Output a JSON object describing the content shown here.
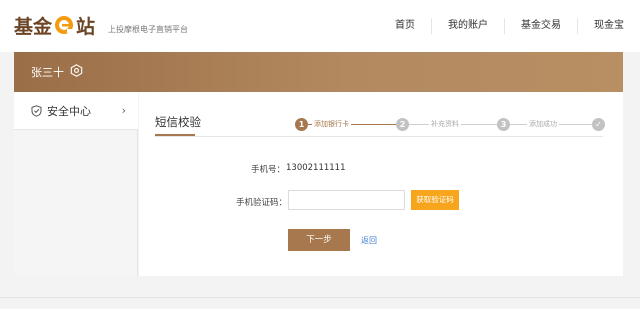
{
  "header": {
    "logo": {
      "part1": "基金",
      "part2": "站",
      "accent": "#f39c12",
      "color": "#6b4526"
    },
    "tagline": "上投摩根电子直销平台",
    "nav": [
      "首页",
      "我的账户",
      "基金交易",
      "现金宝"
    ]
  },
  "user": {
    "name": "张三十",
    "icon": "settings-hexagon-icon"
  },
  "sidebar": {
    "items": [
      {
        "label": "安全中心",
        "icon": "shield-icon",
        "arrow": "›"
      }
    ]
  },
  "main": {
    "tab_title": "短信校验",
    "steps": [
      {
        "number": "1",
        "label": "添加银行卡",
        "state": "active"
      },
      {
        "number": "2",
        "label": "补充资料",
        "state": "pending"
      },
      {
        "number": "3",
        "label": "添加成功",
        "state": "pending"
      },
      {
        "number": "✓",
        "label": "",
        "state": "pending"
      }
    ],
    "form": {
      "phone_label": "手机号：",
      "phone_value": "13002111111",
      "code_label": "手机验证码：",
      "code_value": "",
      "code_placeholder": "",
      "get_code_button": "获取验证码",
      "next_button": "下一步",
      "back_link": "返回"
    }
  },
  "colors": {
    "brand_brown": "#a7784d",
    "button_orange": "#f7a51c",
    "link_blue": "#3f7fd4",
    "step_gray": "#c2c2c2"
  }
}
